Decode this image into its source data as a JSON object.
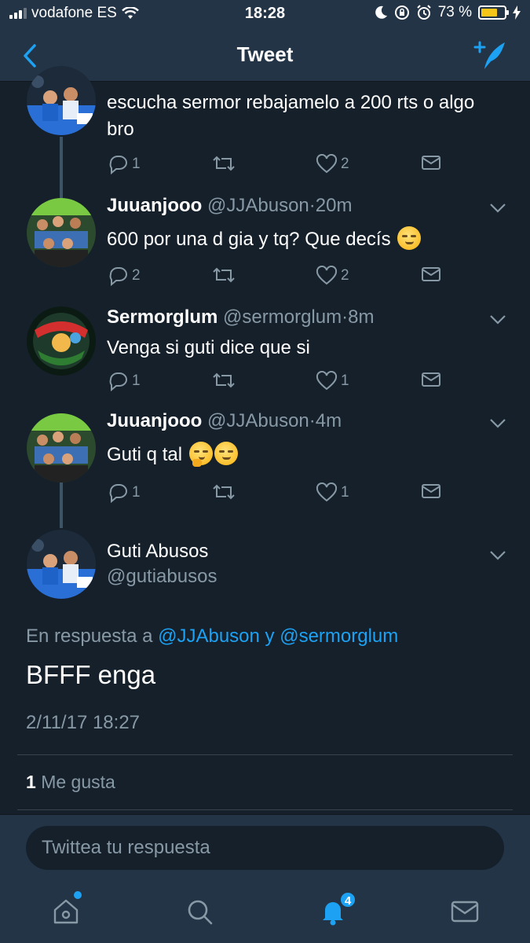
{
  "status_bar": {
    "carrier": "vodafone ES",
    "time": "18:28",
    "battery_percent": "73 %",
    "battery_level": 0.73
  },
  "nav": {
    "title": "Tweet",
    "back_icon": "chevron-left-icon",
    "compose_icon": "compose-tweet-icon"
  },
  "thread": [
    {
      "text": "escucha sermor rebajamelo a 200 rts o algo bro",
      "replies": "1",
      "retweets": "",
      "likes": "2"
    },
    {
      "name": "Juuanjooo",
      "handle": "@JJAbuson",
      "separator": "·",
      "time": "20m",
      "text": "600 por una d gia y tq? Que decís",
      "replies": "2",
      "retweets": "",
      "likes": "2"
    },
    {
      "name": "Sermorglum",
      "handle": "@sermorglum",
      "separator": "·",
      "time": "8m",
      "text": "Venga si guti dice que si",
      "replies": "1",
      "retweets": "",
      "likes": "1"
    },
    {
      "name": "Juuanjooo",
      "handle": "@JJAbuson",
      "separator": "·",
      "time": "4m",
      "text": "Guti q tal",
      "replies": "1",
      "retweets": "",
      "likes": "1"
    }
  ],
  "main_tweet": {
    "name": "Guti Abusos",
    "handle": "@gutiabusos",
    "reply_prefix": "En respuesta a",
    "mention_1": "@JJAbuson",
    "reply_joiner": "y",
    "mention_2": "@sermorglum",
    "text": "BFFF enga",
    "date": "2/11/17 18:27",
    "likes_count": "1",
    "likes_label": "Me gusta"
  },
  "composer": {
    "placeholder": "Twittea tu respuesta"
  },
  "tabbar": {
    "notifications_badge": "4",
    "tabs": [
      "home-icon",
      "search-icon",
      "notifications-icon",
      "messages-icon"
    ]
  },
  "colors": {
    "background": "#15202b",
    "bar": "#243447",
    "accent": "#1da1f2",
    "muted": "#8899a6"
  }
}
